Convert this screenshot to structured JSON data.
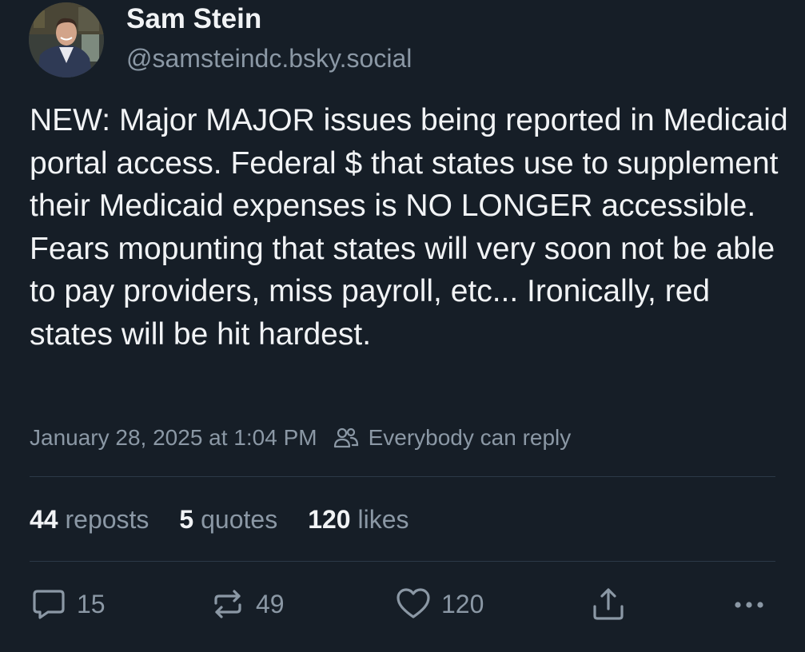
{
  "author": {
    "name": "Sam Stein",
    "handle": "@samsteindc.bsky.social"
  },
  "post": {
    "text": "NEW: Major MAJOR issues being reported in Medicaid portal access. Federal $ that states use to supplement their Medicaid expenses is NO LONGER accessible. Fears mopunting that states will very soon not be able to pay providers, miss payroll, etc... Ironically, red states will be hit hardest.",
    "timestamp": "January 28, 2025 at 1:04 PM",
    "reply_setting": "Everybody can reply"
  },
  "stats": {
    "reposts": {
      "count": "44",
      "label": "reposts"
    },
    "quotes": {
      "count": "5",
      "label": "quotes"
    },
    "likes": {
      "count": "120",
      "label": "likes"
    }
  },
  "actions": {
    "reply": {
      "icon": "reply-icon",
      "count": "15"
    },
    "repost": {
      "icon": "repost-icon",
      "count": "49"
    },
    "like": {
      "icon": "heart-icon",
      "count": "120"
    },
    "share": {
      "icon": "share-icon"
    },
    "more": {
      "icon": "more-icon"
    }
  },
  "colors": {
    "background": "#161e27",
    "text_primary": "#f1f3f5",
    "text_secondary": "#8b98a5",
    "divider": "#2c3947"
  }
}
